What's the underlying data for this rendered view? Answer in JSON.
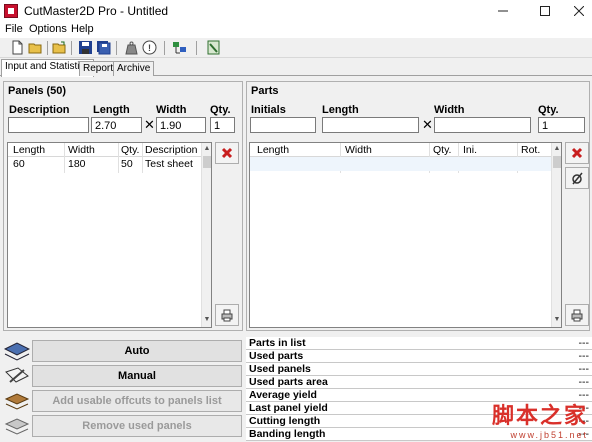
{
  "window": {
    "title": "CutMaster2D Pro - Untitled"
  },
  "menu": [
    "File",
    "Options",
    "Help"
  ],
  "tabs": [
    "Input and Statistics",
    "Report",
    "Archive"
  ],
  "panels": {
    "title": "Panels (50)",
    "labels": {
      "description": "Description",
      "length": "Length",
      "width": "Width",
      "qty": "Qty."
    },
    "inputs": {
      "description": "",
      "length": "2.70",
      "width": "1.90",
      "qty": "1"
    },
    "times": "✕",
    "columns": [
      "Length",
      "Width",
      "Qty.",
      "Description"
    ],
    "rows": [
      {
        "length": "60",
        "width": "180",
        "qty": "50",
        "description": "Test sheet"
      }
    ]
  },
  "parts": {
    "title": "Parts",
    "labels": {
      "initials": "Initials",
      "length": "Length",
      "width": "Width",
      "qty": "Qty."
    },
    "inputs": {
      "initials": "",
      "length": "",
      "width": "",
      "qty": "1"
    },
    "times": "✕",
    "columns": [
      "Length",
      "Width",
      "Qty.",
      "Ini.",
      "Rot."
    ]
  },
  "actions": {
    "auto": "Auto",
    "manual": "Manual",
    "add_offcuts": "Add usable offcuts to panels list",
    "remove_panels": "Remove used panels"
  },
  "stats": [
    {
      "label": "Parts in list",
      "value": "---"
    },
    {
      "label": "Used parts",
      "value": "---"
    },
    {
      "label": "Used panels",
      "value": "---"
    },
    {
      "label": "Used parts area",
      "value": "---"
    },
    {
      "label": "Average yield",
      "value": "---"
    },
    {
      "label": "Last panel yield",
      "value": "---"
    },
    {
      "label": "Cutting length",
      "value": "---"
    },
    {
      "label": "Banding length",
      "value": "---"
    }
  ],
  "watermark": {
    "text": "脚本之家",
    "url": "www.jb51.net"
  },
  "colors": {
    "delete_red": "#c81e1e",
    "watermark_red": "#d9302a"
  }
}
